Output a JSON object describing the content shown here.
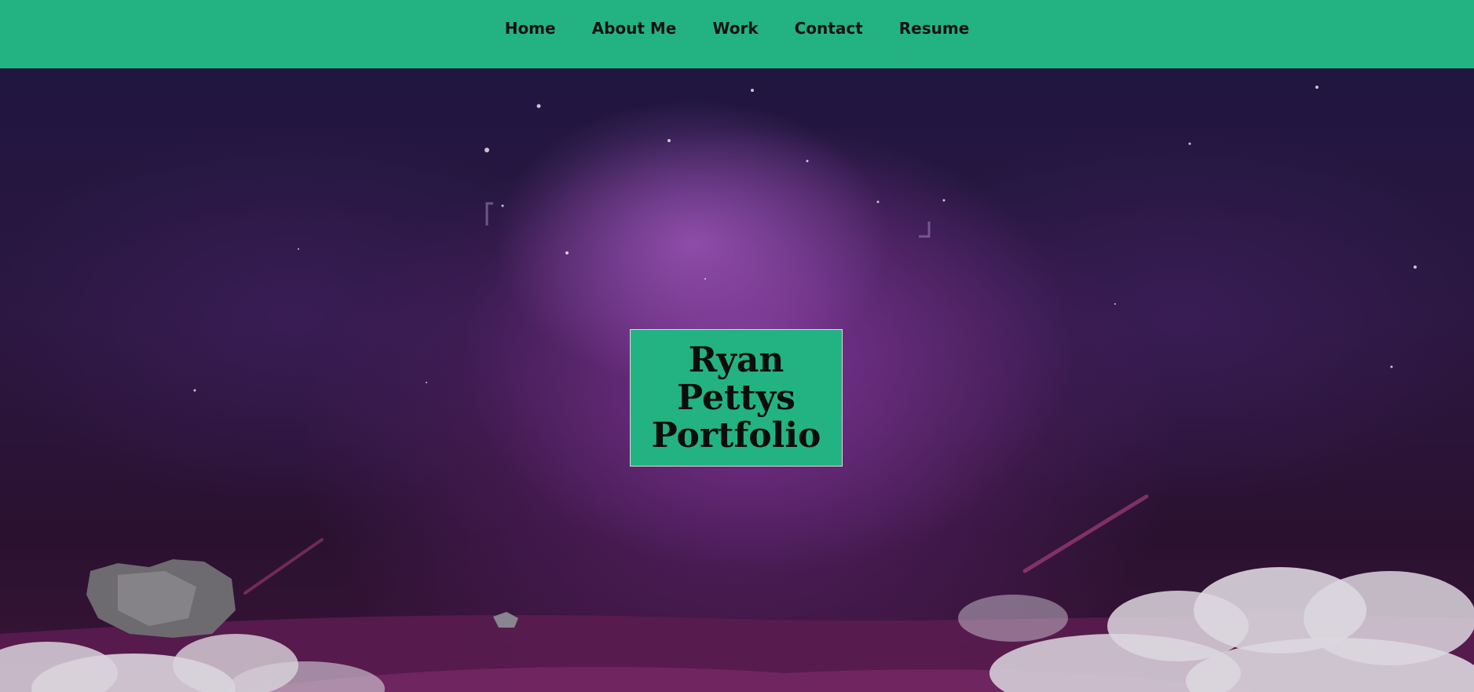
{
  "nav": {
    "items": [
      {
        "label": "Home"
      },
      {
        "label": "About Me"
      },
      {
        "label": "Work"
      },
      {
        "label": "Contact"
      },
      {
        "label": "Resume"
      }
    ]
  },
  "hero": {
    "title_line1": "Ryan Pettys",
    "title_line2": "Portfolio"
  },
  "colors": {
    "nav_background": "#23b382",
    "title_box_background": "#23b382",
    "text": "#131313"
  }
}
